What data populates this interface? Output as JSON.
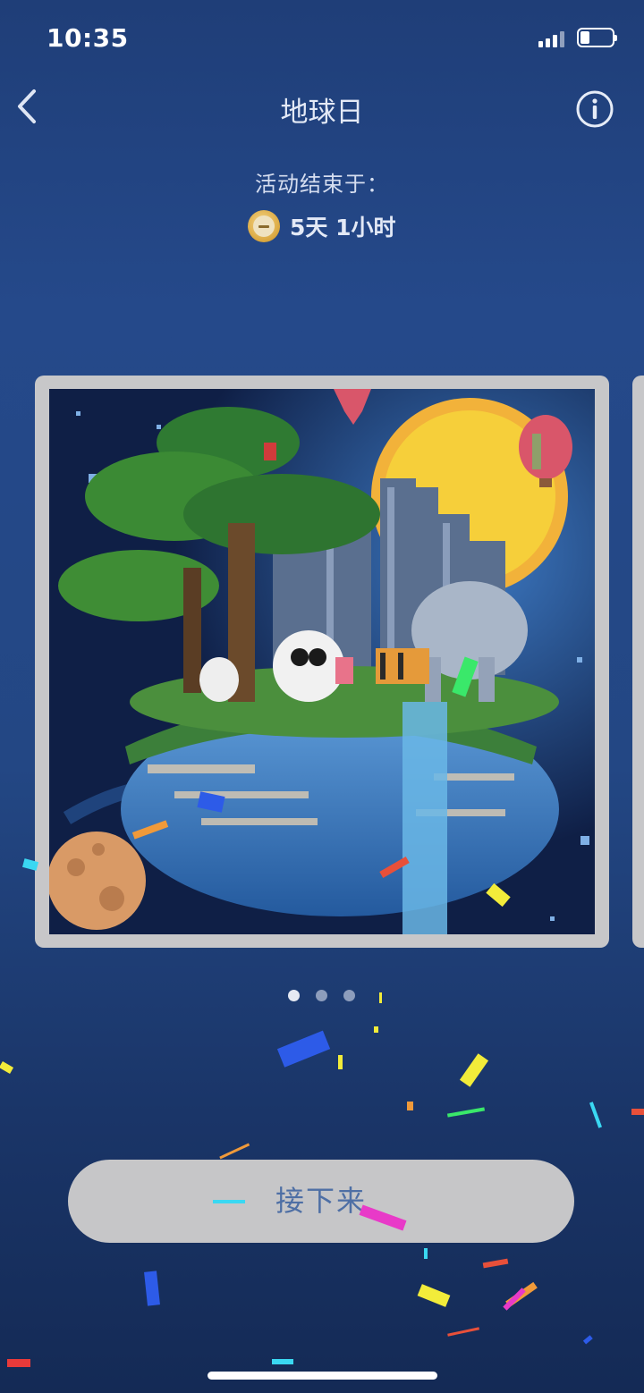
{
  "status_bar": {
    "time": "10:35",
    "signal_icon": "cellular-signal-icon",
    "battery_icon": "battery-icon"
  },
  "nav": {
    "title": "地球日",
    "back_icon": "chevron-left-icon",
    "info_icon": "info-circle-icon"
  },
  "event": {
    "ends_label": "活动结束于：",
    "remaining": "5天 1小时",
    "timer_icon": "coin-clock-icon"
  },
  "carousel": {
    "image_desc": "pixel-art-earth-day-illustration",
    "page_count": 3,
    "current_page": 1
  },
  "actions": {
    "next_label": "接下来"
  },
  "colors": {
    "background_top": "#1f3e78",
    "background_bottom": "#142a55",
    "card_frame": "#c7c7c9",
    "button_bg": "#c6c6c8",
    "button_text": "#4e6fa5"
  }
}
